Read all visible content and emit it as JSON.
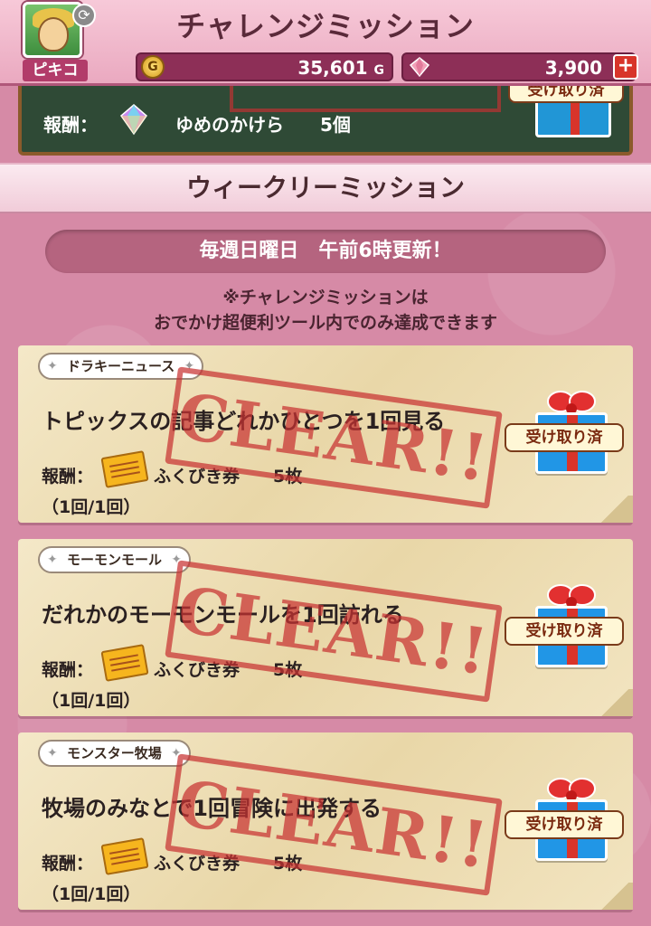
{
  "header": {
    "title": "チャレンジミッション",
    "player_name": "ピキコ",
    "gold": "35,601",
    "gold_unit": "G",
    "gems": "3,900",
    "coin_icon": "coin-icon",
    "gem_icon": "gem-icon"
  },
  "top_card": {
    "reward_label": "報酬：",
    "reward_name": "ゆめのかけら",
    "reward_count": "5個",
    "claimed_label": "受け取り済"
  },
  "section": {
    "title": "ウィークリーミッション",
    "update_text": "毎週日曜日　午前6時更新！",
    "note_line1": "※チャレンジミッションは",
    "note_line2": "おでかけ超便利ツール内でのみ達成できます"
  },
  "missions": [
    {
      "tag": "ドラキーニュース",
      "title": "トピックスの記事どれかひとつを1回見る",
      "reward_label": "報酬：",
      "reward_name": "ふくびき券",
      "reward_count": "5枚",
      "progress": "（1回/1回）",
      "stamp": "CLEAR!!",
      "claimed_label": "受け取り済"
    },
    {
      "tag": "モーモンモール",
      "title": "だれかのモーモンモールを1回訪れる",
      "reward_label": "報酬：",
      "reward_name": "ふくびき券",
      "reward_count": "5枚",
      "progress": "（1回/1回）",
      "stamp": "CLEAR!!",
      "claimed_label": "受け取り済"
    },
    {
      "tag": "モンスター牧場",
      "title": "牧場のみなとで1回冒険に出発する",
      "reward_label": "報酬：",
      "reward_name": "ふくびき券",
      "reward_count": "5枚",
      "progress": "（1回/1回）",
      "stamp": "CLEAR!!",
      "claimed_label": "受け取り済"
    }
  ],
  "colors": {
    "background": "#d68aa6",
    "header": "#eaa9c0",
    "currency_bar": "#8d2f57",
    "gift_box": "#2196e6",
    "ribbon": "#d8342a",
    "stamp": "#c83232"
  }
}
